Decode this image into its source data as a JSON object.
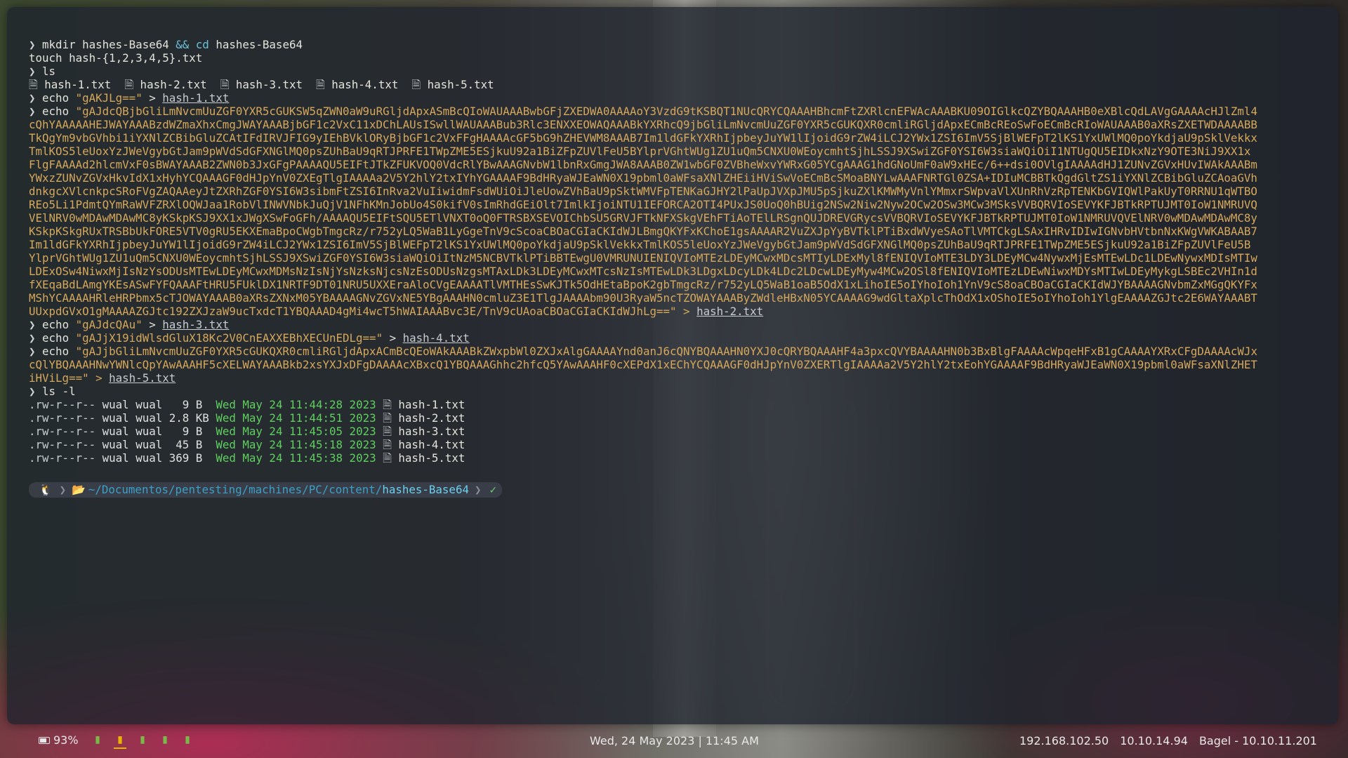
{
  "terminal": {
    "lines": [
      {
        "type": "cmd",
        "parts": [
          [
            "prompt",
            "❯ "
          ],
          [
            "cmd",
            "mkdir hashes-Base64 "
          ],
          [
            "kw",
            "&&"
          ],
          [
            "cmd",
            " "
          ],
          [
            "kw",
            "cd"
          ],
          [
            "cmd",
            " hashes-Base64"
          ]
        ]
      },
      {
        "type": "cmd",
        "parts": [
          [
            "cmd",
            "touch hash-{1,2,3,4,5}.txt"
          ]
        ]
      },
      {
        "type": "cmd",
        "parts": [
          [
            "prompt",
            "❯ "
          ],
          [
            "cmd",
            "ls"
          ]
        ]
      },
      {
        "type": "files",
        "items": [
          "hash-1.txt",
          "hash-2.txt",
          "hash-3.txt",
          "hash-4.txt",
          "hash-5.txt"
        ]
      },
      {
        "type": "cmd",
        "parts": [
          [
            "prompt",
            "❯ "
          ],
          [
            "cmd",
            "echo "
          ],
          [
            "str",
            "\"gAKJLg==\""
          ],
          [
            "cmd",
            " > "
          ],
          [
            "link",
            "hash-1.txt"
          ]
        ]
      },
      {
        "type": "cmd",
        "parts": [
          [
            "prompt",
            "❯ "
          ],
          [
            "cmd",
            "echo "
          ],
          [
            "str",
            "\"gAJdcQBjbGliLmNvcmUuZGF0YXR5cGUKSW5qZWN0aW9uRGljdApxASmBcQIoWAUAAABwbGFjZXEDWA0AAAAoY3VzdG9tKSBQT1NUcQRYCQAAAHBhcmFtZXRlcnEFWAcAAABKU09OIGlkcQZYBQAAAHB0eXBlcQdLAVgGAAAAcHJlZml4"
          ]
        ]
      },
      {
        "type": "cont",
        "text": "cQhYAAAAAHEJWAYAAABzdWZmaXhxCmgJWAYAAABjbGF1c2VxC11xDChLAUsISwllWAUAAABub3Rlc3ENXXEOWAQAAABkYXRhcQ9jbGliLmNvcmUuZGF0YXR5cGUKQXR0cmliRGljdApxECmBcREoSwFoECmBcRIoWAUAAAB0aXRsZXETWDAAAABB"
      },
      {
        "type": "cont",
        "text": "TkQgYm9vbGVhbi1iYXNlZCBibGluZCAtIFdIRVJFIG9yIEhBVklORyBjbGF1c2VxFFgHAAAAcGF5bG9hZHEVWM8AAAB7Im1ldGFkYXRhIjpbeyJuYW1lIjoidG9rZW4iLCJ2YWx1ZSI6ImV5SjBlWEFpT2lKS1YxUWlMQ0poYkdjaU9pSklVekkx"
      },
      {
        "type": "cont",
        "text": "TmlKOS5leUoxYzJWeVgybGtJam9pWVdSdGFXNGlMQ0psZUhBaU9qRTJPRFE1TWpZME5ESjkuU92a1BiZFpZUVlFeU5BYlprVGhtWUg1ZU1uQm5CNXU0WEoycmhtSjhLSSJ9XSwiZGF0YSI6W3siaWQiOiI1NTUgQU5EIDkxNzY9OTE3NiJ9XX1x"
      },
      {
        "type": "cont",
        "text": "FlgFAAAAd2hlcmVxF0sBWAYAAAB2ZWN0b3JxGFgPAAAAQU5EIFtJTkZFUKVOQ0VdcRlYBwAAAGNvbW1lbnRxGmgJWA8AAAB0ZW1wbGF0ZVBheWxvYWRxG05YCgAAAG1hdGNoUmF0aW9xHEc/6++dsi0OVlgIAAAAdHJ1ZUNvZGVxHUvIWAkAAABm"
      },
      {
        "type": "cont",
        "text": "YWxzZUNvZGVxHkvIdX1xHyhYCQAAAGF0dHJpYnV0ZXEgTlgIAAAAa2V5Y2hlY2txIYhYGAAAAF9BdHRyaWJEaWN0X19pbml0aWFsaXNlZHEiiHViSwVoECmBcSMoaBNYLwAAAFNRTGl0ZSA+IDIuMCBBTkQgdGltZS1iYXNlZCBibGluZCAoaGVh"
      },
      {
        "type": "cont",
        "text": "dnkgcXVlcnkpcSRoFVgZAQAAeyJtZXRhZGF0YSI6W3sibmFtZSI6InRva2VuIiwidmFsdWUiOiJleUowZVhBaU9pSktWMVFpTENKaGJHY2lPaUpJVXpJMU5pSjkuZXlKMWMyVnlYMmxrSWpvaVlXUnRhVzRpTENKbGVIQWlPakUyT0RRNU1qWTBO"
      },
      {
        "type": "cont",
        "text": "REo5Li1PdmtQYmRaWVFZRXlOQWJaa1RobVlINWVNbkJuQjV1NFhKMnJobUo4S0kifV0sImRhdGEiOlt7ImlkIjoiNTU1IEFORCA2OTI4PUxJS0UoQ0hBUig2NSw2Niw2Nyw2OCw2OSw3MCw3MSksVVBQRVIoSEVYKFJBTkRPTUJMT0IoW1NMRUVQ"
      },
      {
        "type": "cont",
        "text": "VElNRV0wMDAwMDAwMC8yKSkpKSJ9XX1xJWgXSwFoGFh/AAAAQU5EIFtSQU5ETlVNXT0oQ0FTRSBXSEVOIChbSU5GRVJFTkNFXSkgVEhFTiAoTElLRSgnQUJDREVGRycsVVBQRVIoSEVYKFJBTkRPTUJMT0IoW1NMRUVQVElNRV0wMDAwMDAwMC8y"
      },
      {
        "type": "cont",
        "text": "KSkpKSkgRUxTRSBbUkFORE5VTV0gRU5EKXEmaBpoCWgbTmgcRz/r752yLQ5WaB1LyGgeTnV9cScoaCBOaCGIaCKIdWJLBmgQKYFxKChoE1gsAAAAR2VuZXJpYyBVTklPTiBxdWVyeSAoTlVMTCkgLSAxIHRvIDIwIGNvbHVtbnNxKWgVWKABAAB7"
      },
      {
        "type": "cont",
        "text": "Im1ldGFkYXRhIjpbeyJuYW1lIjoidG9rZW4iLCJ2YWx1ZSI6ImV5SjBlWEFpT2lKS1YxUWlMQ0poYkdjaU9pSklVekkxTmlKOS5leUoxYzJWeVgybGtJam9pWVdSdGFXNGlMQ0psZUhBaU9qRTJPRFE1TWpZME5ESjkuU92a1BiZFpZUVlFeU5B"
      },
      {
        "type": "cont",
        "text": "YlprVGhtWUg1ZU1uQm5CNXU0WEoycmhtSjhLSSJ9XSwiZGF0YSI6W3siaWQiOiItNzM5NCBVTklPTiBBTEwgU0VMRUNUIENIQVIoMTEzLDEyMCwxMDcsMTIyLDExMyl8fENIQVIoMTE3LDY3LDEyMCw4NywxMjEsMTEwLDc1LDEwNywxMDIsMTIw"
      },
      {
        "type": "cont",
        "text": "LDExOSw4NiwxMjIsNzYsODUsMTEwLDEyMCwxMDMsNzIsNjYsNzksNjcsNzEsODUsNzgsMTAxLDk3LDEyMCwxMTcsNzIsMTEwLDk3LDgxLDcyLDk4LDc2LDcwLDEyMyw4MCw2OSl8fENIQVIoMTEzLDEwNiwxMDYsMTIwLDEyMykgLSBEc2VHIn1d"
      },
      {
        "type": "cont",
        "text": "fXEqaBdLAmgYKEsASwFYFQAAAFtHRU5FUklDX1NRTF9DT01NRU5UXXEraAloCVgEAAAATlVMTHEsSwKJTk5OdHEtaBpoK2gbTmgcRz/r752yLQ5WaB1oaB5OdX1xLihoIE5oIYhoIoh1YnV9cS8oaCBOaCGIaCKIdWJYBAAAAGNvbmZxMGgQKYFx"
      },
      {
        "type": "cont",
        "text": "MShYCAAAAHRleHRPbmx5cTJOWAYAAAB0aXRsZXNxM05YBAAAAGNvZGVxNE5YBgAAAHN0cmluZ3E1TlgJAAAAbm90U3RyaW5ncTZOWAYAAAByZWdleHBxN05YCAAAAG9wdGltaXplcThOdX1xOShoIE5oIYhoIoh1YlgEAAAAZGJtc2E6WAYAAABT"
      },
      {
        "type": "cont",
        "text": "UUxpdGVxO1gMAAAAZGJtc192ZXJzaW9ucTxdcT1YBQAAAD4gMi4wcT5hWAIAAABvc3E/TnV9cUAoaCBOaCGIaCKIdWJhLg==\" > ",
        "link": "hash-2.txt"
      },
      {
        "type": "cmd",
        "parts": [
          [
            "prompt",
            "❯ "
          ],
          [
            "cmd",
            "echo "
          ],
          [
            "str",
            "\"gAJdcQAu\""
          ],
          [
            "cmd",
            " > "
          ],
          [
            "link",
            "hash-3.txt"
          ]
        ]
      },
      {
        "type": "cmd",
        "parts": [
          [
            "prompt",
            "❯ "
          ],
          [
            "cmd",
            "echo "
          ],
          [
            "str",
            "\"gAJjX19idWlsdGluX18Kc2V0CnEAXXEBhXECUnEDLg==\""
          ],
          [
            "cmd",
            " > "
          ],
          [
            "link",
            "hash-4.txt"
          ]
        ]
      },
      {
        "type": "cmd",
        "parts": [
          [
            "prompt",
            "❯ "
          ],
          [
            "cmd",
            "echo "
          ],
          [
            "str",
            "\"gAJjbGliLmNvcmUuZGF0YXR5cGUKQXR0cmliRGljdApxACmBcQEoWAkAAABkZWxpbWl0ZXJxAlgGAAAAYnd0anJ6cQNYBQAAAHN0YXJ0cQRYBQAAAHF4a3pxcQVYBAAAAHN0b3BxBlgFAAAAcWpqeHFxB1gCAAAAYXRxCFgDAAAAcWJx"
          ]
        ]
      },
      {
        "type": "cont",
        "text": "cQlYBQAAAHNwYWNlcQpYAwAAAHF5cXELWAYAAABkb2xsYXJxDFgDAAAAcXBxcQ1YBQAAAGhhc2hfcQ5YAwAAAHF0cXEPdX1xEChYCQAAAGF0dHJpYnV0ZXERTlgIAAAAa2V5Y2hlY2txEohYGAAAAF9BdHRyaWJEaWN0X19pbml0aWFsaXNlZHET"
      },
      {
        "type": "cont",
        "text": "iHViLg==\" > ",
        "link": "hash-5.txt"
      },
      {
        "type": "cmd",
        "parts": [
          [
            "prompt",
            "❯ "
          ],
          [
            "cmd",
            "ls -l"
          ]
        ]
      },
      {
        "type": "lsl",
        "perm": ".rw-r--r--",
        "owner": "wual",
        "group": "wual",
        "size": "  9 B ",
        "date": "Wed May 24 11:44:28 2023",
        "name": "hash-1.txt"
      },
      {
        "type": "lsl",
        "perm": ".rw-r--r--",
        "owner": "wual",
        "group": "wual",
        "size": "2.8 KB",
        "date": "Wed May 24 11:44:51 2023",
        "name": "hash-2.txt"
      },
      {
        "type": "lsl",
        "perm": ".rw-r--r--",
        "owner": "wual",
        "group": "wual",
        "size": "  9 B ",
        "date": "Wed May 24 11:45:05 2023",
        "name": "hash-3.txt"
      },
      {
        "type": "lsl",
        "perm": ".rw-r--r--",
        "owner": "wual",
        "group": "wual",
        "size": " 45 B ",
        "date": "Wed May 24 11:45:18 2023",
        "name": "hash-4.txt"
      },
      {
        "type": "lsl",
        "perm": ".rw-r--r--",
        "owner": "wual",
        "group": "wual",
        "size": "369 B ",
        "date": "Wed May 24 11:45:38 2023",
        "name": "hash-5.txt"
      }
    ],
    "powerline": {
      "path_prefix": "~/Documentos/pentesting/machines/PC/content/",
      "path_current": "hashes-Base64",
      "status": "✓"
    }
  },
  "statusbar": {
    "battery": "93%",
    "workspaces_count": 5,
    "active_workspace": 2,
    "clock": "Wed, 24 May 2023 | 11:45 AM",
    "ip_local": "192.168.102.50",
    "ip_vpn": "10.10.14.94",
    "target": "Bagel - 10.10.11.201"
  },
  "colors": {
    "prompt": "#cfd3d6",
    "string": "#d6a85c",
    "keyword": "#6cc0d8",
    "date": "#5fd05f",
    "path": "#3aa0c8",
    "battery_accent": "#e8b400",
    "workspace": "#7ab84a"
  }
}
